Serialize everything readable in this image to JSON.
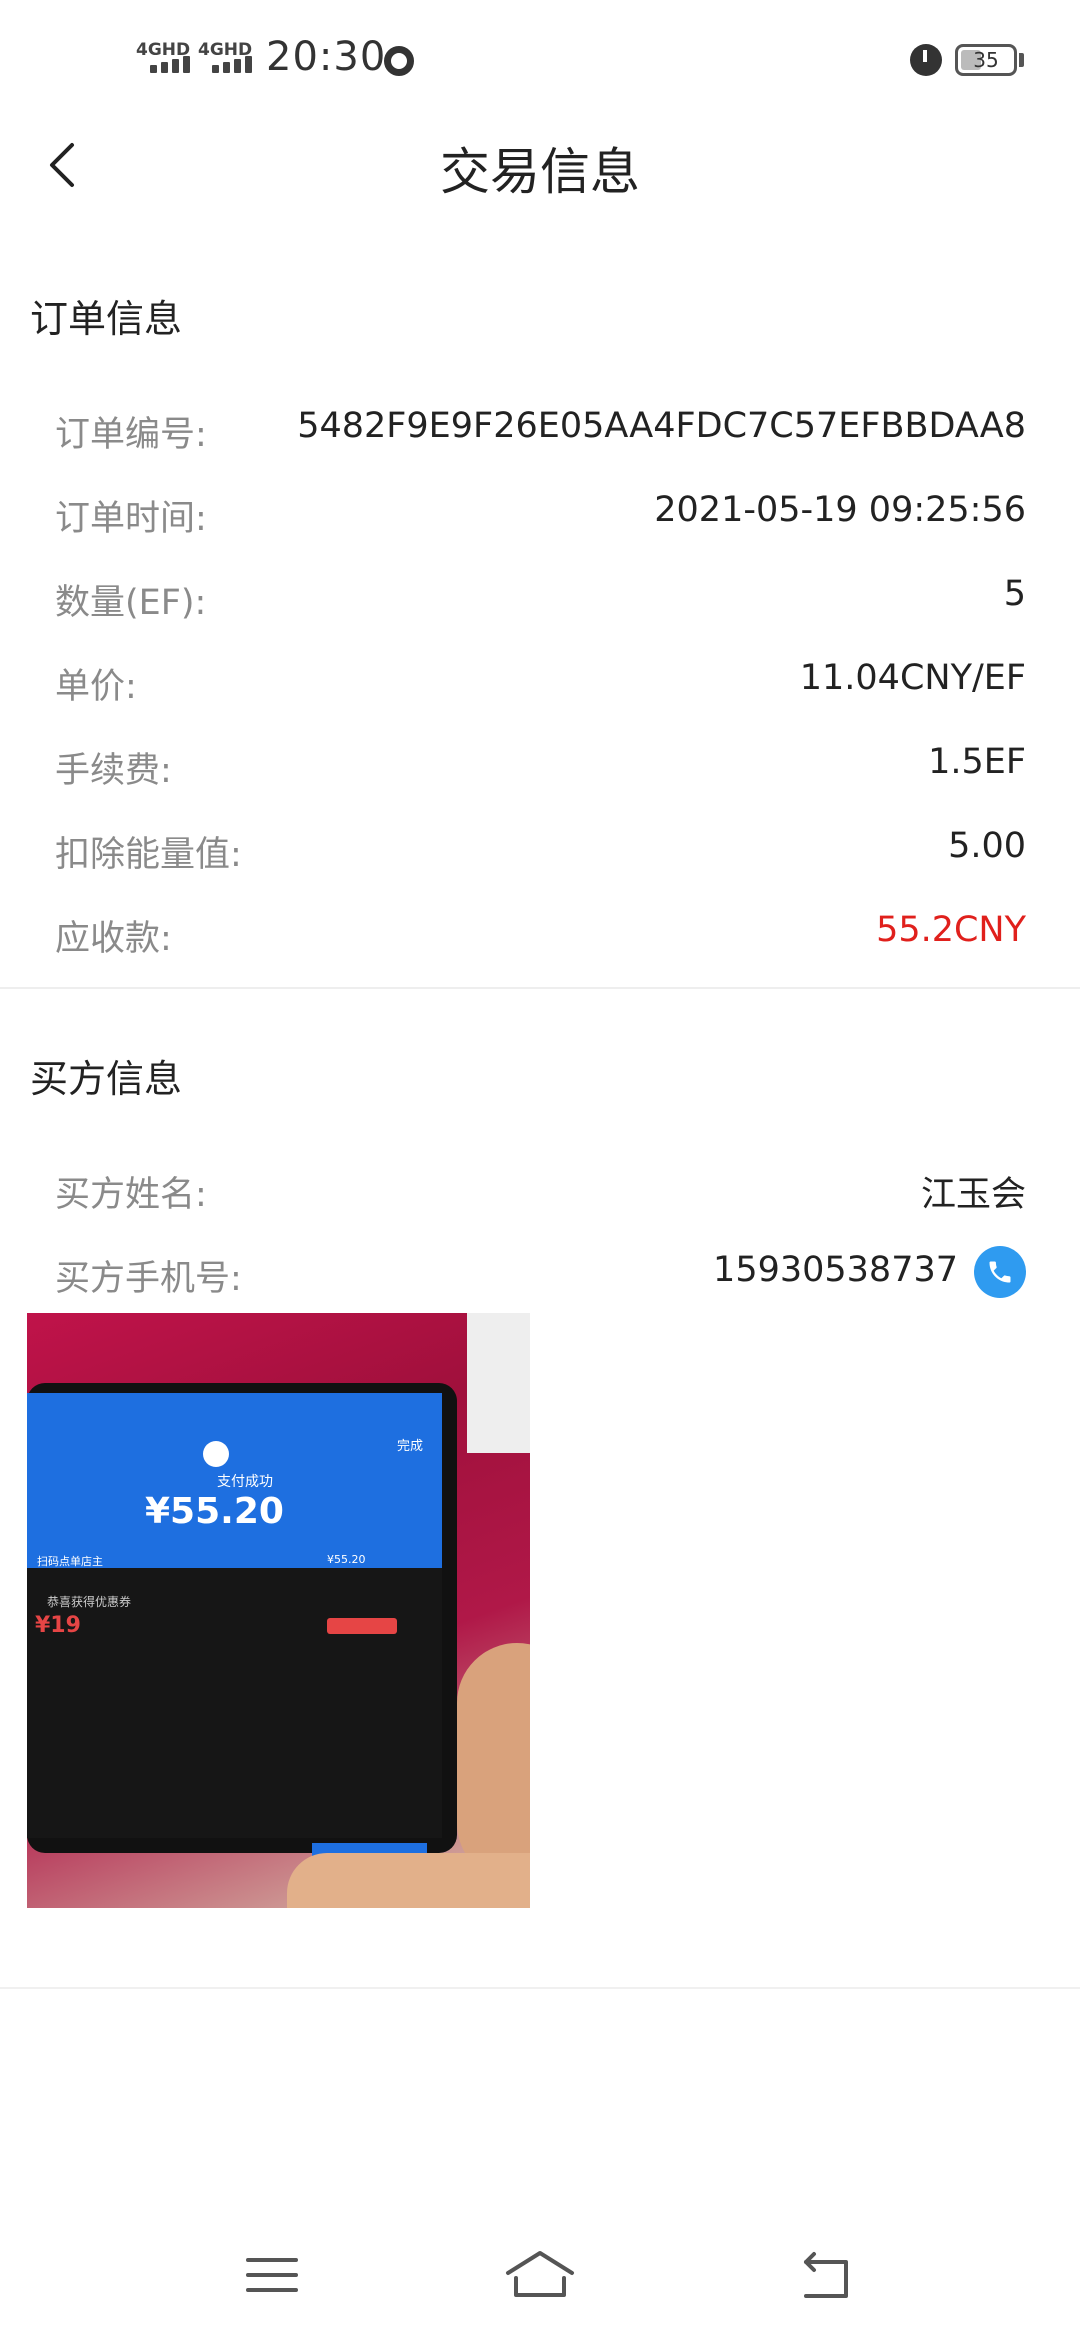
{
  "status_bar": {
    "network_1": "4GHD",
    "network_2": "4GHD",
    "time": "20:30",
    "battery": "35"
  },
  "header": {
    "title": "交易信息"
  },
  "order_section": {
    "title": "订单信息",
    "rows": [
      {
        "label": "订单编号:",
        "value": "5482F9E9F26E05AA4FDC7C57EFBBDAA8"
      },
      {
        "label": "订单时间:",
        "value": "2021-05-19 09:25:56"
      },
      {
        "label": "数量(EF):",
        "value": "5"
      },
      {
        "label": "单价:",
        "value": "11.04CNY/EF"
      },
      {
        "label": "手续费:",
        "value": "1.5EF"
      },
      {
        "label": "扣除能量值:",
        "value": "5.00"
      },
      {
        "label": "应收款:",
        "value": "55.2CNY"
      }
    ]
  },
  "buyer_section": {
    "title": "买方信息",
    "name_label": "买方姓名:",
    "name_value": "江玉会",
    "phone_label": "买方手机号:",
    "phone_value": "15930538737"
  },
  "payment_photo": {
    "status_text": "支付成功",
    "amount": "¥55.20",
    "done_label": "完成",
    "row_left": "扫码点单店主",
    "row_right": "¥55.20",
    "coupon_text": "恭喜获得优惠券",
    "coupon_value": "¥19"
  },
  "colors": {
    "accent_blue": "#2f9bf0",
    "highlight_underline": "#b8d9f5",
    "amount_red": "#e0201c"
  },
  "icons": {
    "back": "back-chevron-icon",
    "phone": "phone-call-icon",
    "menu": "menu-icon",
    "home": "home-icon",
    "return": "return-icon"
  }
}
